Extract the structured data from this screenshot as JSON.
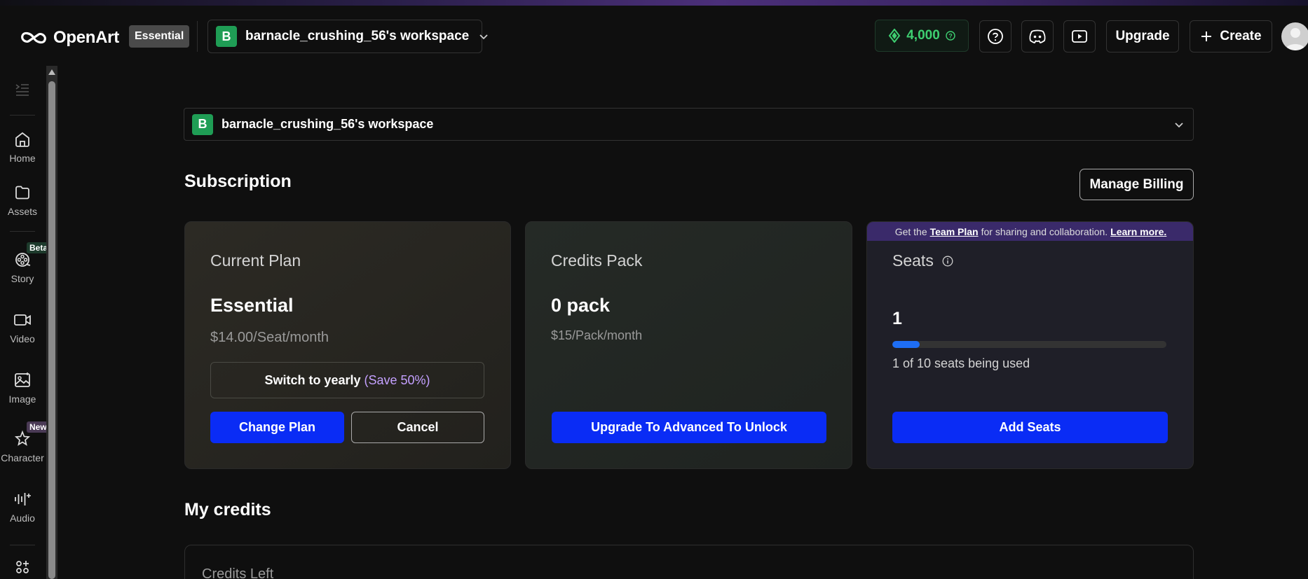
{
  "header": {
    "logo_text": "OpenArt",
    "plan_badge": "Essential",
    "workspace": {
      "avatar_letter": "B",
      "name": "barnacle_crushing_56's workspace"
    },
    "credits": "4,000",
    "upgrade_label": "Upgrade",
    "create_label": "Create"
  },
  "sidebar": {
    "items": [
      {
        "label": "Home"
      },
      {
        "label": "Assets"
      },
      {
        "label": "Story",
        "tag": "Beta"
      },
      {
        "label": "Video"
      },
      {
        "label": "Image"
      },
      {
        "label": "Character",
        "tag": "New"
      },
      {
        "label": "Audio"
      }
    ]
  },
  "main": {
    "workspace": {
      "avatar_letter": "B",
      "name": "barnacle_crushing_56's workspace"
    },
    "subscription_title": "Subscription",
    "manage_billing_label": "Manage Billing",
    "current_plan": {
      "label": "Current Plan",
      "value": "Essential",
      "price": "$14.00/Seat/month",
      "switch_text": "Switch to yearly",
      "save_text": "(Save 50%)",
      "change_plan_label": "Change Plan",
      "cancel_label": "Cancel"
    },
    "credits_pack": {
      "label": "Credits Pack",
      "value": "0 pack",
      "price": "$15/Pack/month",
      "upgrade_label": "Upgrade To Advanced To Unlock"
    },
    "seats": {
      "promo_prefix": "Get the",
      "promo_link": "Team Plan",
      "promo_middle": "for sharing and collaboration.",
      "promo_learn": "Learn more.",
      "label": "Seats",
      "value": "1",
      "usage_fraction": 0.1,
      "usage_text": "1 of 10 seats being used",
      "add_seats_label": "Add Seats"
    },
    "my_credits_title": "My credits",
    "credits_left_label": "Credits Left"
  },
  "colors": {
    "accent_blue": "#0a2cf5",
    "credits_green": "#3ecf71",
    "workspace_green": "#1f9d55",
    "promo_purple": "#3a2a6a"
  }
}
